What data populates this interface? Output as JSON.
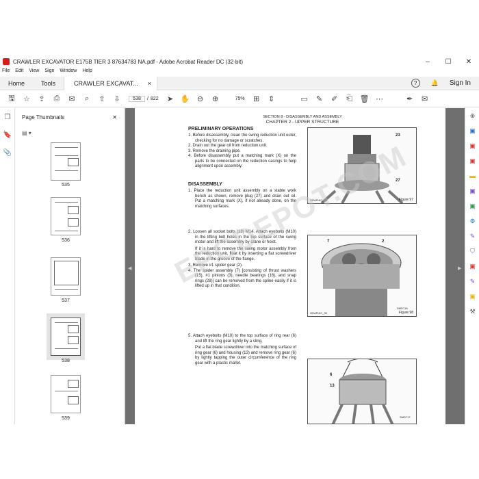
{
  "window": {
    "title": "CRAWLER EXCAVATOR E175B TIER 3 87634783 NA.pdf - Adobe Acrobat Reader DC (32-bit)",
    "minimize": "–",
    "maximize": "☐",
    "close": "✕"
  },
  "menu": [
    "File",
    "Edit",
    "View",
    "Sign",
    "Window",
    "Help"
  ],
  "tabs": {
    "home": "Home",
    "tools": "Tools",
    "doc": "CRAWLER EXCAVAT...",
    "doc_close": "×",
    "help": "?",
    "signin": "Sign In"
  },
  "toolbar": {
    "page_current": "538",
    "page_sep": "/",
    "page_total": "822",
    "zoom": "75%"
  },
  "thumb_panel": {
    "title": "Page Thumbnails",
    "close": "✕",
    "options": "▤ ▾",
    "pages": [
      "535",
      "536",
      "537",
      "538",
      "539"
    ],
    "selected": "538"
  },
  "doc": {
    "header1": "SECTION 8 - DISASSEMBLY AND ASSEMBLY",
    "header2": "CHAPTER 2 - UPPER STRUCTURE",
    "sec1": "PRELIMINARY OPERATIONS",
    "prelim": [
      "1. Before disassembly, clean the swing reduction unit outer, checking for no damage or scratches.",
      "2. Drain out the gear oil from reduction unit.",
      "3. Remove the draining pipe.",
      "4. Before disassembly put a matching mark (X) on the parts to be connected on the reduction casings to help alignment upon assembly."
    ],
    "sec2": "DISASSEMBLY",
    "dis1": [
      "1. Place the reduction unit assembly on a stable work bench as shown, remove plug (27) and drain out oil. Put a matching mark (X), if not already done, on the matching surfaces."
    ],
    "dis2": [
      "2. Loosen all socket bolts (18) M14. Attach eyebolts (M10) in the lifting bolt holes in the top surface of the swing motor and lift the assembly by crane or hoist."
    ],
    "dis2sub": "If it is hard to remove the swing motor assembly from the reduction unit, float it by inserting a flat screwdriver blade in the groove of the flange.",
    "dis3": [
      "3. Remove #1 spider gear (2).",
      "4. The spider assembly (7) [consisting of thrust washers (15), #1 pinions (3), needle bearings (16), and snap rings (28)] can be removed from the spline easily if it is lifted up in that condition."
    ],
    "dis5": [
      "5. Attach eyebolts (M10) to the top surface of ring rear (6) and lift the ring gear lightly by a sling."
    ],
    "dis5sub": "Put a flat blade screwdriver into the matching surface of ring gear (6) and housing (13) and remove ring gear (6) by lightly tapping the outer circumference of the ring gear with a plastic mallet.",
    "fig97": {
      "caption": "Figure 97",
      "src": "GRAPHIC_33",
      "c1": "23",
      "c2": "27"
    },
    "fig98": {
      "caption": "Figure 98",
      "src": "GRAPHIC_33",
      "c1": "7",
      "c2": "2",
      "code": "SMD718"
    },
    "fig99": {
      "c1": "6",
      "c2": "13",
      "code": "SMD717"
    },
    "watermark": "EPCDEPOT.COM"
  }
}
